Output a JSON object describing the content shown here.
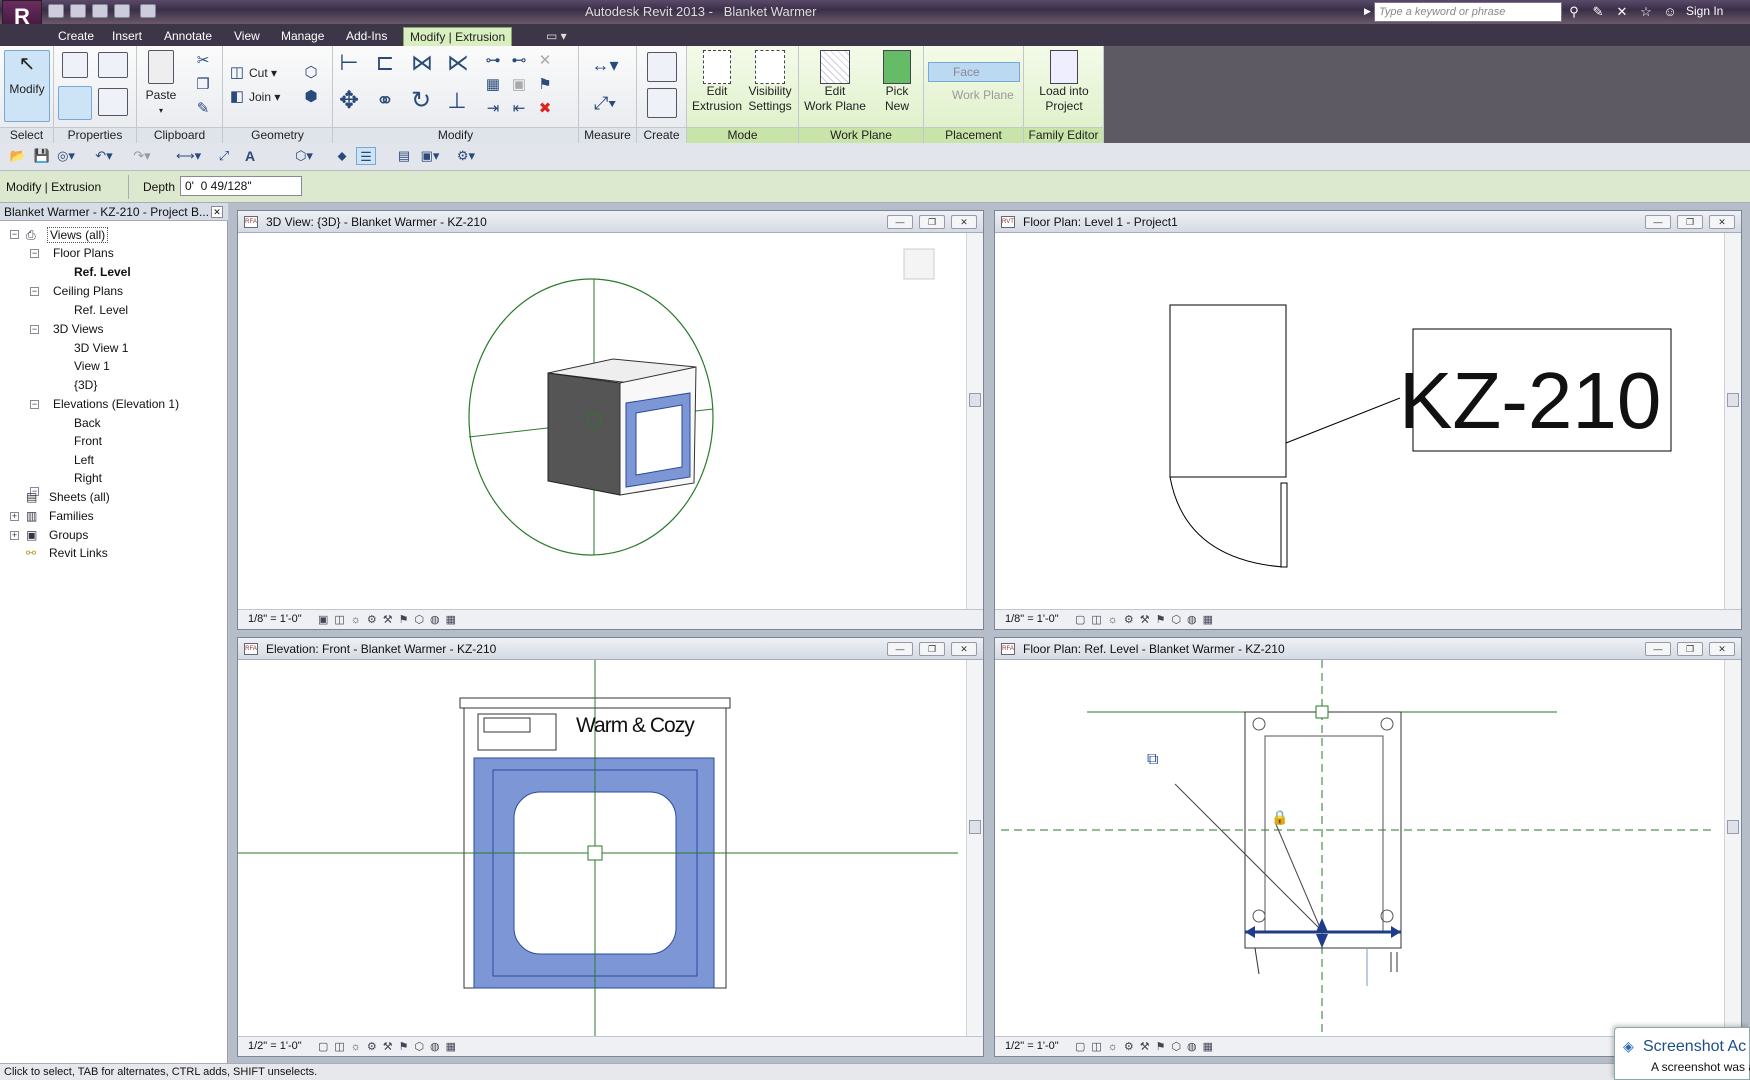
{
  "app": {
    "title": "Autodesk Revit 2013 -",
    "doc": "Blanket Warmer",
    "search_placeholder": "Type a keyword or phrase",
    "sign_in": "Sign In"
  },
  "tabs": [
    "Create",
    "Insert",
    "Annotate",
    "View",
    "Manage",
    "Add-Ins",
    "Modify | Extrusion"
  ],
  "ribbon": {
    "panels": [
      "Select",
      "Properties",
      "Clipboard",
      "Geometry",
      "Modify",
      "Measure",
      "Create",
      "Mode",
      "Work Plane",
      "Placement",
      "Family Editor"
    ],
    "modify_label": "Modify",
    "paste_label": "Paste",
    "cut_label": "Cut",
    "join_label": "Join",
    "edit_extrusion": [
      "Edit",
      "Extrusion"
    ],
    "visibility_settings": [
      "Visibility",
      "Settings"
    ],
    "edit_work_plane": [
      "Edit",
      "Work Plane"
    ],
    "pick_new": [
      "Pick",
      "New"
    ],
    "face": "Face",
    "work_plane": "Work Plane",
    "load_into_project": [
      "Load into",
      "Project"
    ]
  },
  "options_bar": {
    "context": "Modify | Extrusion",
    "depth_label": "Depth",
    "depth_value": "0'  0 49/128\""
  },
  "project_browser": {
    "title": "Blanket Warmer - KZ-210 - Project B...",
    "items": [
      "Views (all)",
      "Floor Plans",
      "Ref. Level",
      "Ceiling Plans",
      "Ref. Level",
      "3D Views",
      "3D View 1",
      "View 1",
      "{3D}",
      "Elevations (Elevation 1)",
      "Back",
      "Front",
      "Left",
      "Right",
      "Sheets (all)",
      "Families",
      "Groups",
      "Revit Links"
    ]
  },
  "views": [
    {
      "title": "3D View: {3D} - Blanket Warmer - KZ-210",
      "scale": "1/8\" = 1'-0\""
    },
    {
      "title": "Floor Plan: Level 1 - Project1",
      "scale": "1/8\" = 1'-0\"",
      "tag": "KZ-210"
    },
    {
      "title": "Elevation: Front - Blanket Warmer - KZ-210",
      "scale": "1/2\" = 1'-0\"",
      "brand": "Warm & Cozy"
    },
    {
      "title": "Floor Plan: Ref. Level - Blanket Warmer - KZ-210",
      "scale": "1/2\" = 1'-0\""
    }
  ],
  "status_bar": "Click to select, TAB for alternates, CTRL adds, SHIFT unselects.",
  "toast": {
    "title": "Screenshot Ac",
    "body": "A screenshot was a"
  }
}
